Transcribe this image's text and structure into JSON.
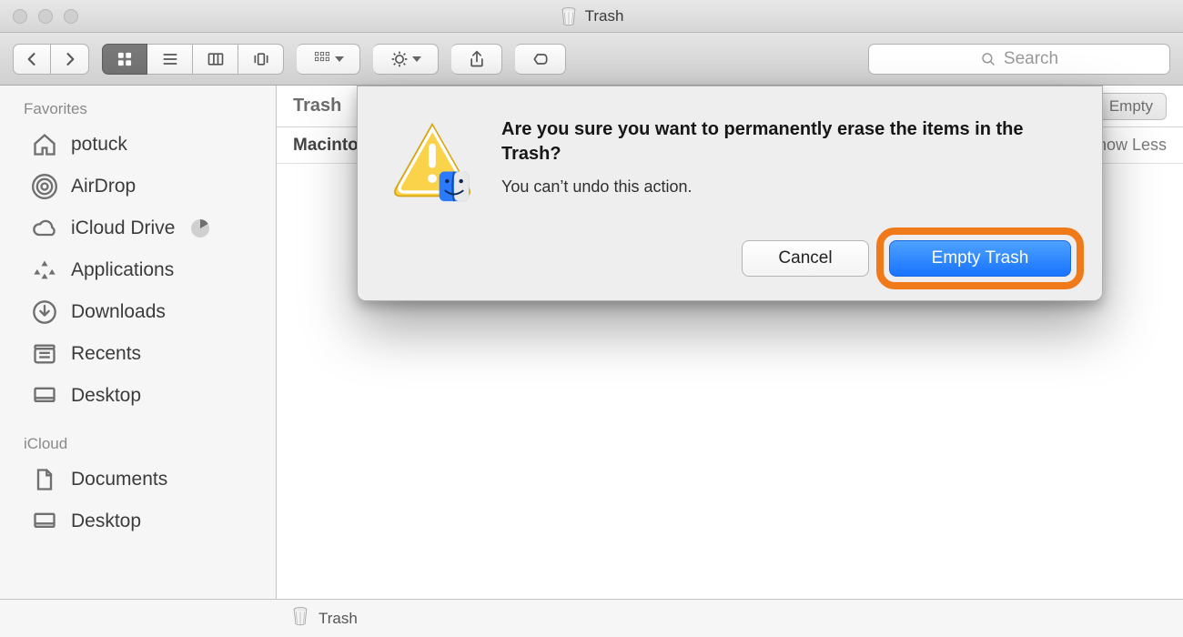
{
  "window": {
    "title": "Trash"
  },
  "toolbar": {
    "search_placeholder": "Search"
  },
  "sidebar": {
    "sections": [
      {
        "heading": "Favorites",
        "items": [
          {
            "icon": "home-icon",
            "label": "potuck"
          },
          {
            "icon": "airdrop-icon",
            "label": "AirDrop"
          },
          {
            "icon": "cloud-icon",
            "label": "iCloud Drive",
            "badge": "pie"
          },
          {
            "icon": "applications-icon",
            "label": "Applications"
          },
          {
            "icon": "downloads-icon",
            "label": "Downloads"
          },
          {
            "icon": "recents-icon",
            "label": "Recents"
          },
          {
            "icon": "desktop-icon",
            "label": "Desktop"
          }
        ]
      },
      {
        "heading": "iCloud",
        "items": [
          {
            "icon": "document-icon",
            "label": "Documents"
          },
          {
            "icon": "desktop-icon",
            "label": "Desktop"
          }
        ]
      }
    ]
  },
  "content": {
    "title": "Trash",
    "empty_button": "Empty",
    "group_label": "Macintosh HD",
    "show_less": "Show Less"
  },
  "dialog": {
    "heading": "Are you sure you want to permanently erase the items in the Trash?",
    "message": "You can’t undo this action.",
    "cancel": "Cancel",
    "confirm": "Empty Trash"
  },
  "pathbar": {
    "label": "Trash"
  },
  "colors": {
    "primary_blue": "#2a7bff",
    "highlight_orange": "#f07a1a"
  }
}
